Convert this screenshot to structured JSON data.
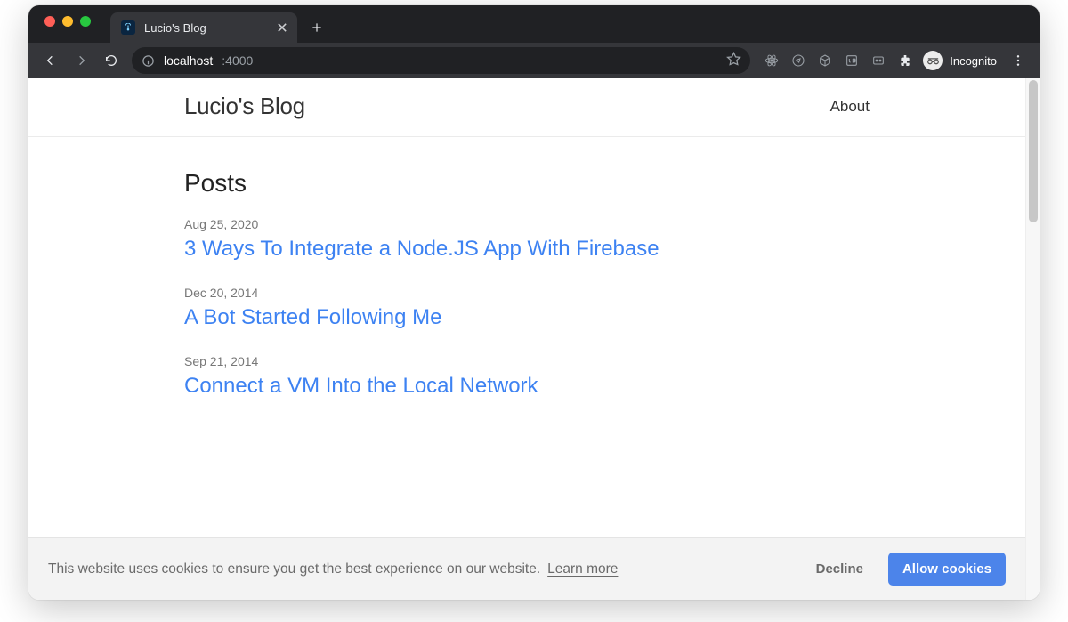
{
  "browser": {
    "tab_title": "Lucio's Blog",
    "url_host": "localhost",
    "url_port": ":4000",
    "profile_label": "Incognito"
  },
  "site": {
    "title": "Lucio's Blog",
    "nav": {
      "about": "About"
    }
  },
  "posts_heading": "Posts",
  "posts": [
    {
      "date": "Aug 25, 2020",
      "title": "3 Ways To Integrate a Node.JS App With Firebase"
    },
    {
      "date": "Dec 20, 2014",
      "title": "A Bot Started Following Me"
    },
    {
      "date": "Sep 21, 2014",
      "title": "Connect a VM Into the Local Network"
    }
  ],
  "cookie": {
    "message": "This website uses cookies to ensure you get the best experience on our website.",
    "learn_more": "Learn more",
    "decline": "Decline",
    "allow": "Allow cookies"
  }
}
